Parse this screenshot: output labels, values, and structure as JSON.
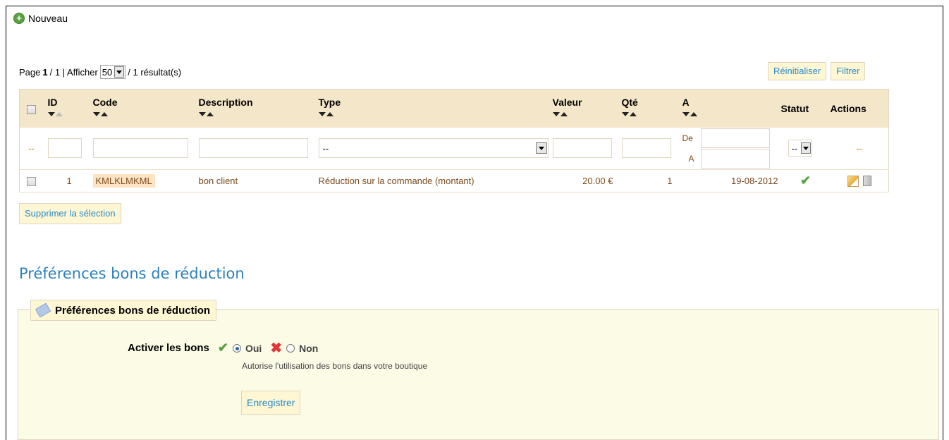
{
  "toolbar": {
    "new_label": "Nouveau"
  },
  "pager": {
    "page_prefix": "Page",
    "page_current": "1",
    "page_total": "/ 1 | Afficher",
    "per_page": "50",
    "results": "/ 1 résultat(s)"
  },
  "buttons": {
    "reset": "Réinitialiser",
    "filter": "Filtrer",
    "delete_selection": "Supprimer la sélection"
  },
  "table": {
    "columns": {
      "id": "ID",
      "code": "Code",
      "description": "Description",
      "type": "Type",
      "value": "Valeur",
      "qty": "Qté",
      "to": "A",
      "status": "Statut",
      "actions": "Actions"
    },
    "filter": {
      "type_value": "--",
      "date_from": "De",
      "date_to": "A",
      "status_value": "--",
      "dash": "--"
    },
    "rows": [
      {
        "id": "1",
        "code": "KMLKLMKML",
        "description": "bon client",
        "type": "Réduction sur la commande (montant)",
        "value": "20.00 €",
        "qty": "1",
        "date": "19-08-2012",
        "status": "active"
      }
    ]
  },
  "preferences": {
    "title": "Préférences bons de réduction",
    "legend": "Préférences bons de réduction",
    "enable_label": "Activer les bons",
    "yes": "Oui",
    "no": "Non",
    "help": "Autorise l'utilisation des bons dans votre boutique",
    "save": "Enregistrer"
  },
  "colors": {
    "accent": "#268ccd",
    "header_bg": "#f4e6c9",
    "row_text": "#7c4b1e",
    "fieldset_bg": "#fbfbe6"
  }
}
